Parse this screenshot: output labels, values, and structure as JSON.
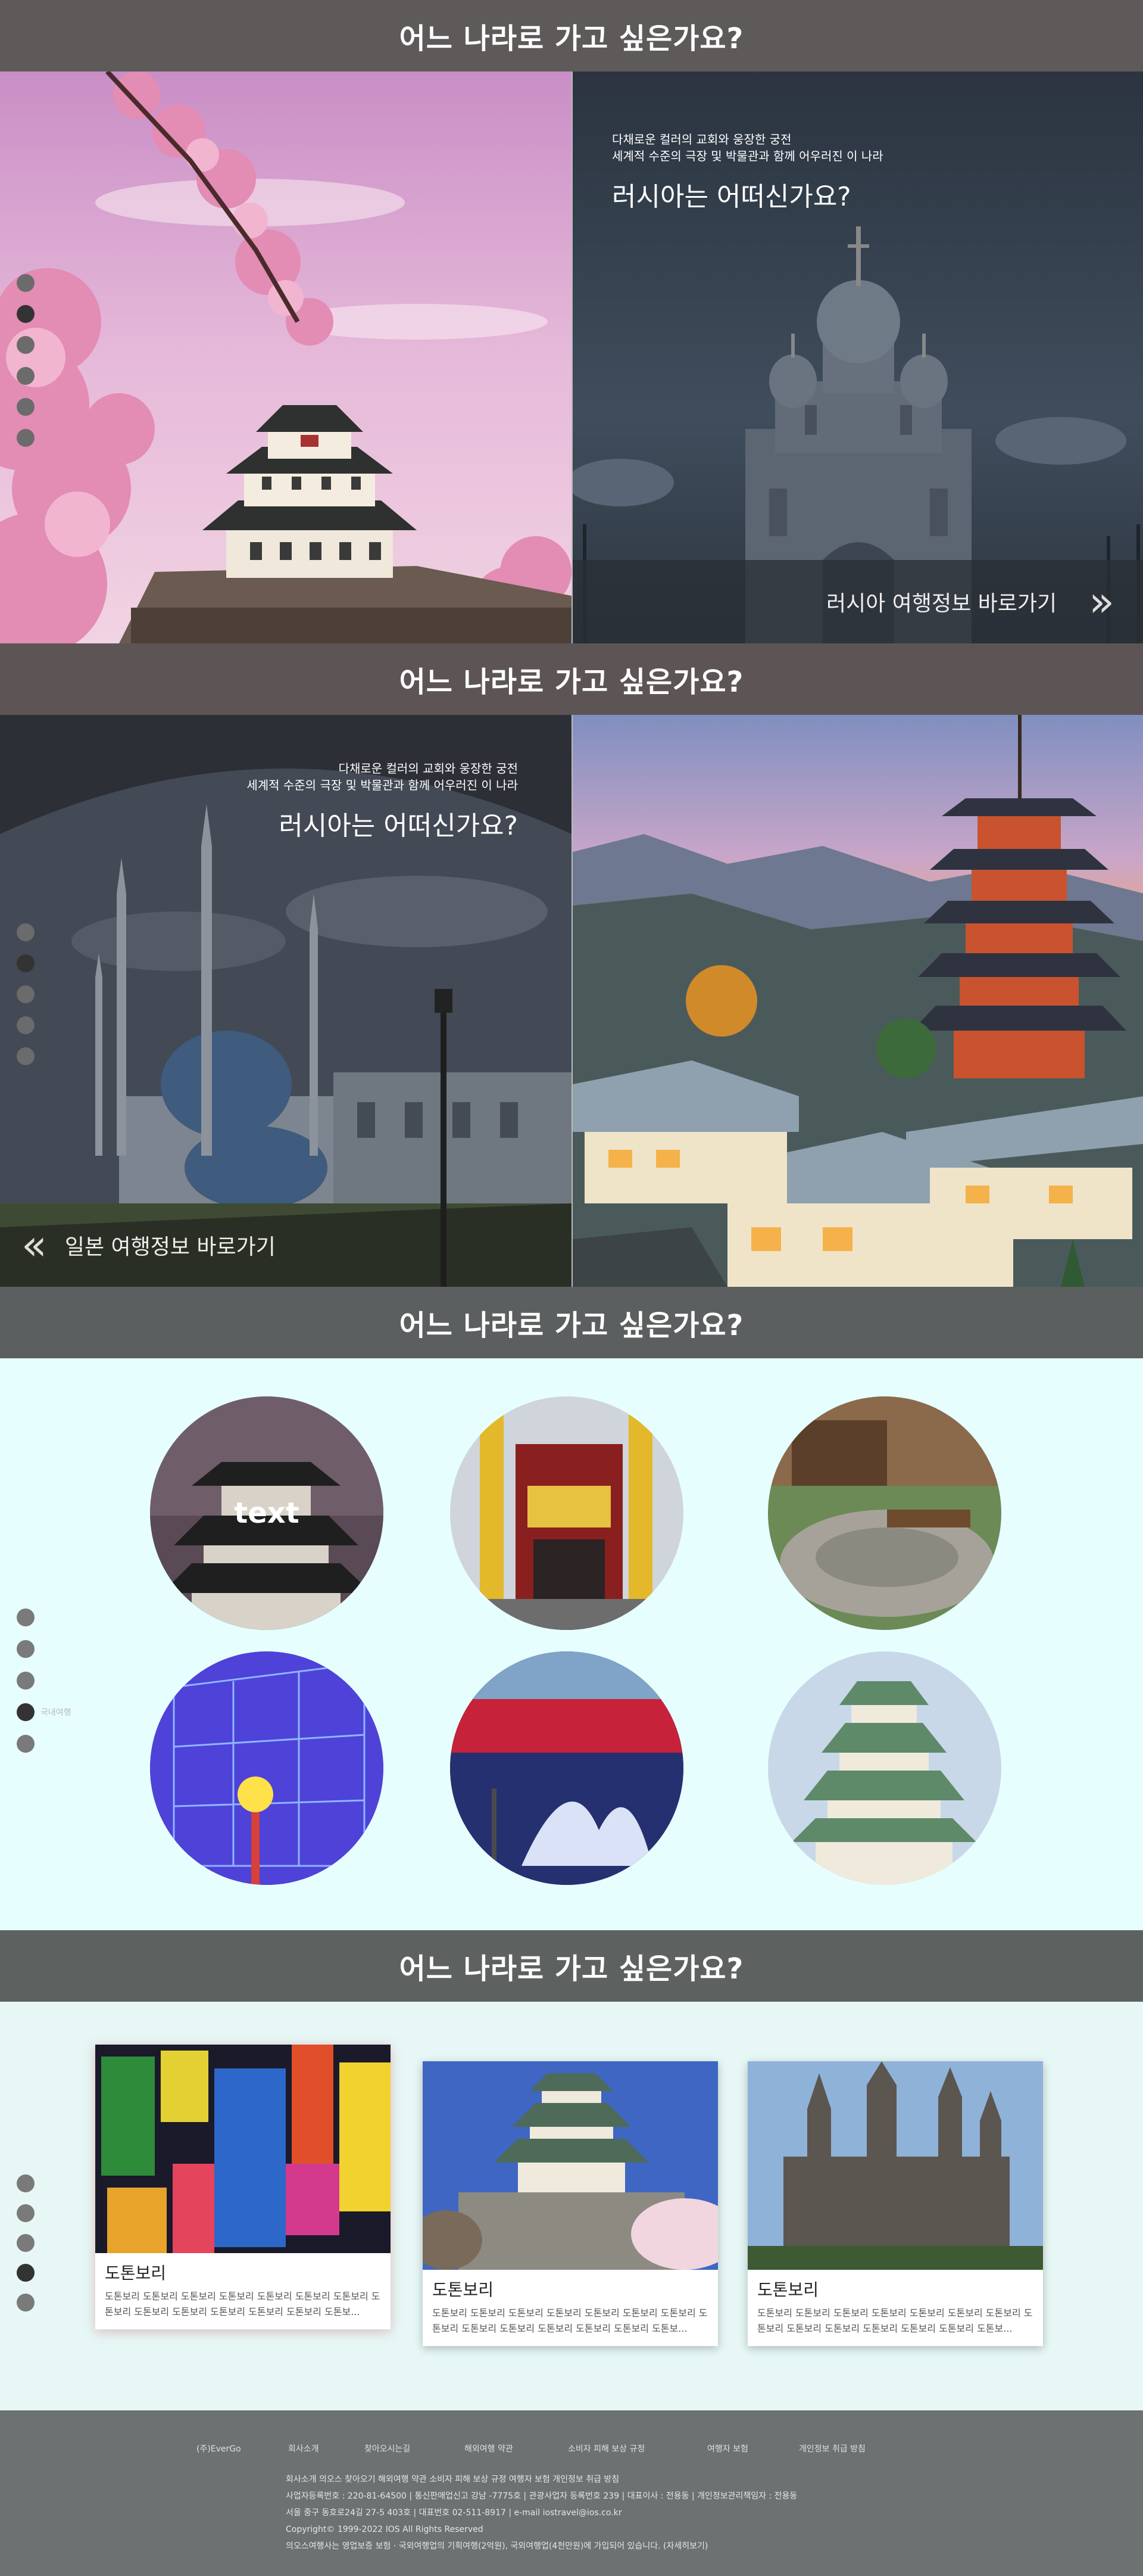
{
  "headers": [
    "어느 나라로 가고 싶은가요?",
    "어느 나라로 가고 싶은가요?",
    "어느 나라로 가고 싶은가요?",
    "어느 나라로 가고 싶은가요?"
  ],
  "section1": {
    "sub_line1": "다채로운 컬러의 교회와 웅장한 궁전",
    "sub_line2": "세계적 수준의 극장 및 박물관과 함께 어우러진 이 나라",
    "question": "러시아는 어떠신가요?",
    "link_label": "러시아 여행정보 바로가기",
    "link_icon": "double-chevron-right"
  },
  "section2": {
    "sub_line1": "다채로운 컬러의 교회와 웅장한 궁전",
    "sub_line2": "세계적 수준의 극장 및 박물관과 함께 어우러진 이 나라",
    "question": "러시아는 어떠신가요?",
    "link_label": "일본 여행정보 바로가기",
    "link_icon": "double-chevron-left"
  },
  "section3": {
    "circle_text": "text",
    "dot_label": "국내여행",
    "active_dot": 4
  },
  "section4": {
    "cards": [
      {
        "title": "도톤보리",
        "desc": "도톤보리 도톤보리 도톤보리 도톤보리 도톤보리 도톤보리 도톤보리 도톤보리 도톤보리 도톤보리 도톤보리 도톤보리 도톤보리 도톤보..."
      },
      {
        "title": "도톤보리",
        "desc": "도톤보리 도톤보리 도톤보리 도톤보리 도톤보리 도톤보리 도톤보리 도톤보리 도톤보리 도톤보리 도톤보리 도톤보리 도톤보리 도톤보..."
      },
      {
        "title": "도톤보리",
        "desc": "도톤보리 도톤보리 도톤보리 도톤보리 도톤보리 도톤보리 도톤보리 도톤보리 도톤보리 도톤보리 도톤보리 도톤보리 도톤보리 도톤보..."
      }
    ],
    "active_dot": 4
  },
  "footer": {
    "nav": [
      "(주)EverGo",
      "회사소개",
      "찾아오시는길",
      "해외여행 약관",
      "소비자 피해 보상 규정",
      "여행자 보험",
      "개인정보 취급 방침"
    ],
    "info": [
      "회사소개 의오스 찾아오기 해외여행 약관 소비자 피해 보상 규정 여행자 보험 개인정보 취급 방침",
      "사업자등록번호 : 220-81-64500 | 통신판매업신고 강남 -7775호 | 관광사업자 등록번호 239 | 대표이사 : 전용동 | 개인정보관리책임자 : 전용동",
      "서울 중구 동호로24길 27-5 403호 | 대표번호 02-511-8917 | e-mail iostravel@ios.co.kr",
      "Copyright© 1999-2022 IOS All Rights Reserved",
      "의오스여행사는 영업보증 보험 · 국외여행업의 기획여행(2억원), 국외여행업(4천만원)에 가입되어 있습니다. (자세히보기)"
    ]
  },
  "colors": {
    "header_bg": "#5e5a5a",
    "circle_bg": "#e6fffe",
    "cards_bg": "#e6f7f6",
    "footer_bg": "#6c7271"
  }
}
